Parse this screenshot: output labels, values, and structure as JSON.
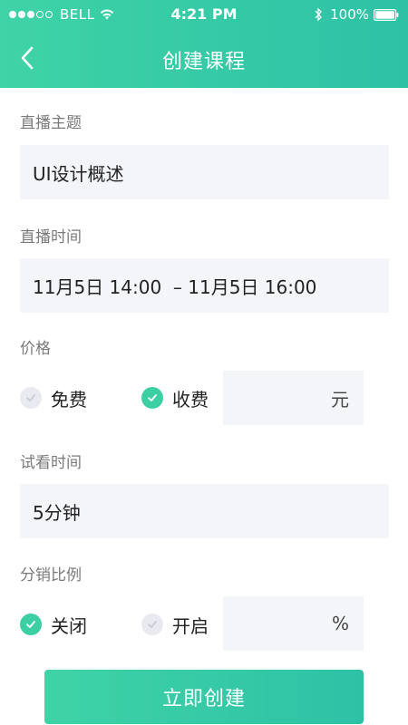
{
  "status_bar": {
    "carrier": "BELL",
    "time": "4:21 PM",
    "battery": "100%"
  },
  "nav": {
    "title": "创建课程"
  },
  "form": {
    "topic": {
      "label": "直播主题",
      "value": "UI设计概述"
    },
    "time": {
      "label": "直播时间",
      "value": "11月5日 14:00  – 11月5日 16:00"
    },
    "price": {
      "label": "价格",
      "options": [
        {
          "label": "免费",
          "selected": false
        },
        {
          "label": "收费",
          "selected": true
        }
      ],
      "unit": "元"
    },
    "trial": {
      "label": "试看时间",
      "value": "5分钟"
    },
    "distribution": {
      "label": "分销比例",
      "options": [
        {
          "label": "关闭",
          "selected": true
        },
        {
          "label": "开启",
          "selected": false
        }
      ],
      "unit": "%"
    }
  },
  "actions": {
    "create_label": "立即创建"
  },
  "colors": {
    "accent": "#3ccfa4",
    "field_bg": "#f4f5f8",
    "label_text": "#7a7a7a"
  }
}
